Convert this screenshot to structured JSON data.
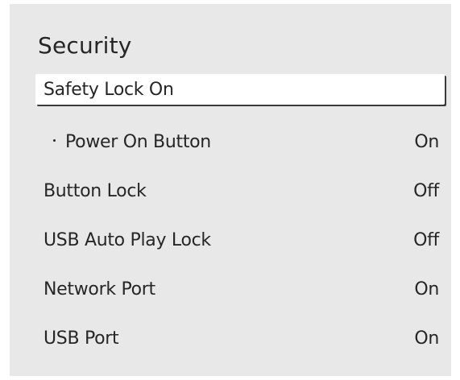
{
  "menu": {
    "title": "Security",
    "items": [
      {
        "label": "Safety Lock On",
        "value": ""
      },
      {
        "label": "Power On Button",
        "value": "On"
      },
      {
        "label": "Button Lock",
        "value": "Off"
      },
      {
        "label": "USB Auto Play Lock",
        "value": "Off"
      },
      {
        "label": "Network Port",
        "value": "On"
      },
      {
        "label": "USB Port",
        "value": "On"
      }
    ]
  },
  "colors": {
    "panel_background": "#e8e8e8",
    "selected_background": "#ffffff",
    "text": "#262626"
  }
}
